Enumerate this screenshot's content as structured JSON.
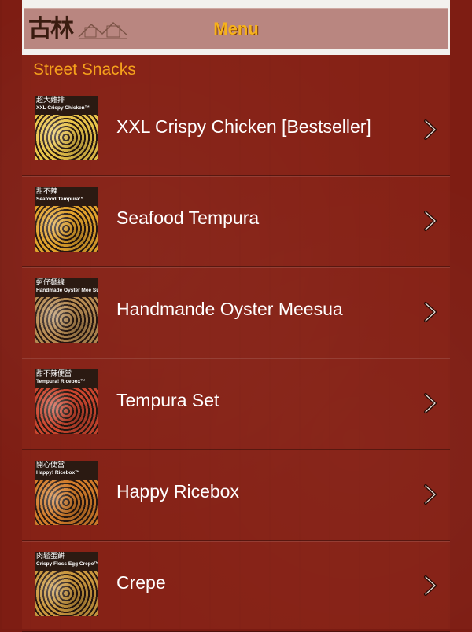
{
  "header": {
    "title": "Menu",
    "logo_text": "古林"
  },
  "section": {
    "title": "Street Snacks"
  },
  "items": [
    {
      "label": "XXL Crispy Chicken [Bestseller]",
      "thumb_zh": "超大雞排",
      "thumb_en": "XXL Crispy Chicken™",
      "thumb_color": "#e8c24a"
    },
    {
      "label": "Seafood Tempura",
      "thumb_zh": "甜不辣",
      "thumb_en": "Seafood Tempura™",
      "thumb_color": "#e0a12c"
    },
    {
      "label": "Handmande Oyster Meesua",
      "thumb_zh": "蚵仔麵線",
      "thumb_en": "Handmade Oyster Mee Sua™",
      "thumb_color": "#b58a52"
    },
    {
      "label": "Tempura Set",
      "thumb_zh": "甜不辣便當",
      "thumb_en": "Tempura! Ricebox™",
      "thumb_color": "#c9452e"
    },
    {
      "label": "Happy Ricebox",
      "thumb_zh": "開心便當",
      "thumb_en": "Happy! Ricebox™",
      "thumb_color": "#d07b2a"
    },
    {
      "label": "Crepe",
      "thumb_zh": "肉鬆蛋餅",
      "thumb_en": "Crispy Floss Egg Crepe™",
      "thumb_color": "#c8963e"
    }
  ],
  "colors": {
    "background": "#7e1d13",
    "title_accent": "#f6b21b",
    "section_accent": "#f5a11c"
  }
}
